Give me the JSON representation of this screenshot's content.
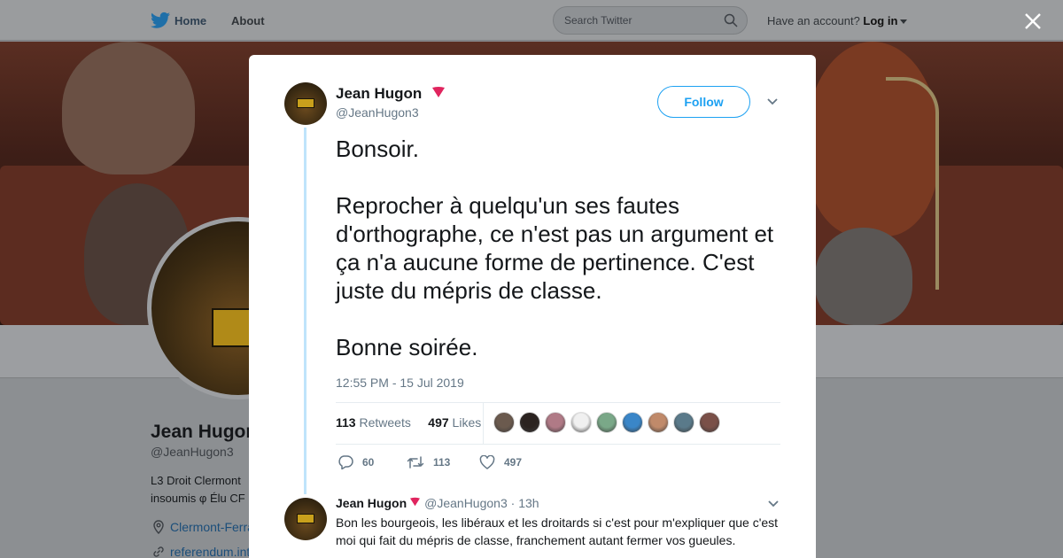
{
  "topbar": {
    "home_label": "Home",
    "about_label": "About",
    "search_placeholder": "Search Twitter",
    "account_prompt": "Have an account?",
    "login_label": "Log in"
  },
  "profile": {
    "name": "Jean Hugon",
    "handle": "@JeanHugon3",
    "bio_line1": "L3 Droit Clermont",
    "bio_line2": "insoumis φ Élu CF",
    "location": "Clermont-Ferra",
    "url": "referendum.int"
  },
  "tweet": {
    "author_name": "Jean Hugon",
    "author_handle": "@JeanHugon3",
    "follow_label": "Follow",
    "text_lines": [
      "Bonsoir.",
      "Reprocher à quelqu'un ses fautes d'orthographe, ce n'est pas un argument et ça n'a aucune forme de pertinence. C'est juste du mépris de classe.",
      "Bonne soirée."
    ],
    "timestamp": "12:55 PM - 15 Jul 2019",
    "retweet_count": "113",
    "retweets_label": "Retweets",
    "like_count": "497",
    "likes_label": "Likes",
    "liker_colors": [
      "#6b5a4e",
      "#2b2320",
      "#b07a86",
      "#f0f0f0",
      "#7aa888",
      "#3a86c8",
      "#c08a6a",
      "#5a7a8a",
      "#7a5048"
    ],
    "actions": {
      "reply_count": "60",
      "retweet_count": "113",
      "like_count": "497"
    }
  },
  "reply": {
    "author_name": "Jean Hugon",
    "author_handle": "@JeanHugon3",
    "separator": "·",
    "age": "13h",
    "text": "Bon les bourgeois, les libéraux et les droitards si c'est pour m'expliquer que c'est moi qui fait du mépris de classe, franchement autant fermer vos gueules."
  },
  "colors": {
    "accent": "#1da1f2",
    "rose": "#e0245e",
    "secondary_text": "#657786"
  },
  "icons": [
    "twitter-bird-icon",
    "search-icon",
    "close-icon",
    "rose-icon",
    "chevron-down-icon",
    "reply-icon",
    "retweet-icon",
    "heart-icon",
    "location-pin-icon",
    "link-icon"
  ]
}
